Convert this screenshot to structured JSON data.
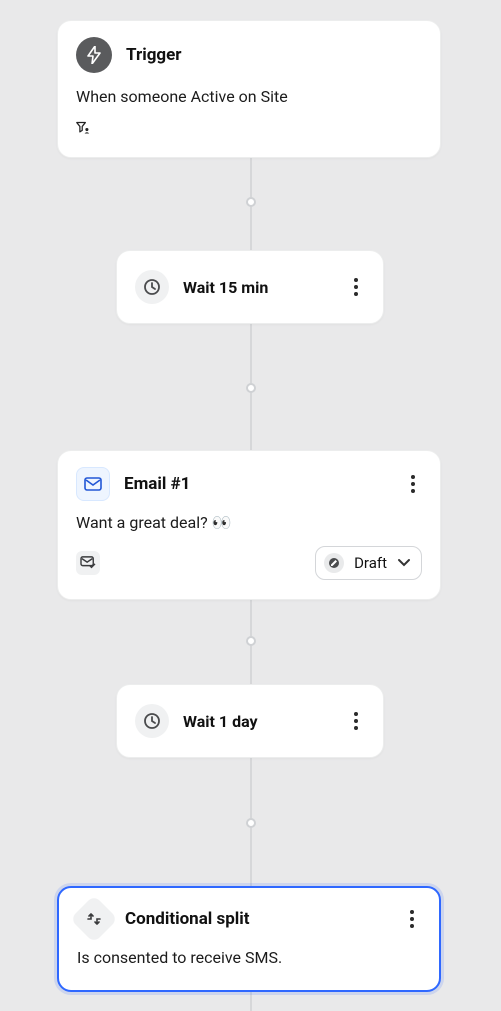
{
  "colors": {
    "canvas_bg": "#e9e9ea",
    "card_bg": "#ffffff",
    "selected_border": "#2f68ff",
    "connector": "#d6d7d9"
  },
  "trigger": {
    "title": "Trigger",
    "description": "When someone Active on Site",
    "filter_icon": "filter-user-icon"
  },
  "wait1": {
    "label": "Wait 15 min",
    "icon": "clock-icon"
  },
  "email1": {
    "title": "Email #1",
    "subject": "Want a great deal? 👀",
    "status": {
      "label": "Draft",
      "icon": "pencil-icon"
    },
    "icon": "envelope-icon",
    "secondary_icon": "envelope-check-icon"
  },
  "wait2": {
    "label": "Wait 1 day",
    "icon": "clock-icon"
  },
  "conditional": {
    "title": "Conditional split",
    "description": "Is consented to receive SMS.",
    "icon": "split-arrows-icon",
    "selected": true
  }
}
